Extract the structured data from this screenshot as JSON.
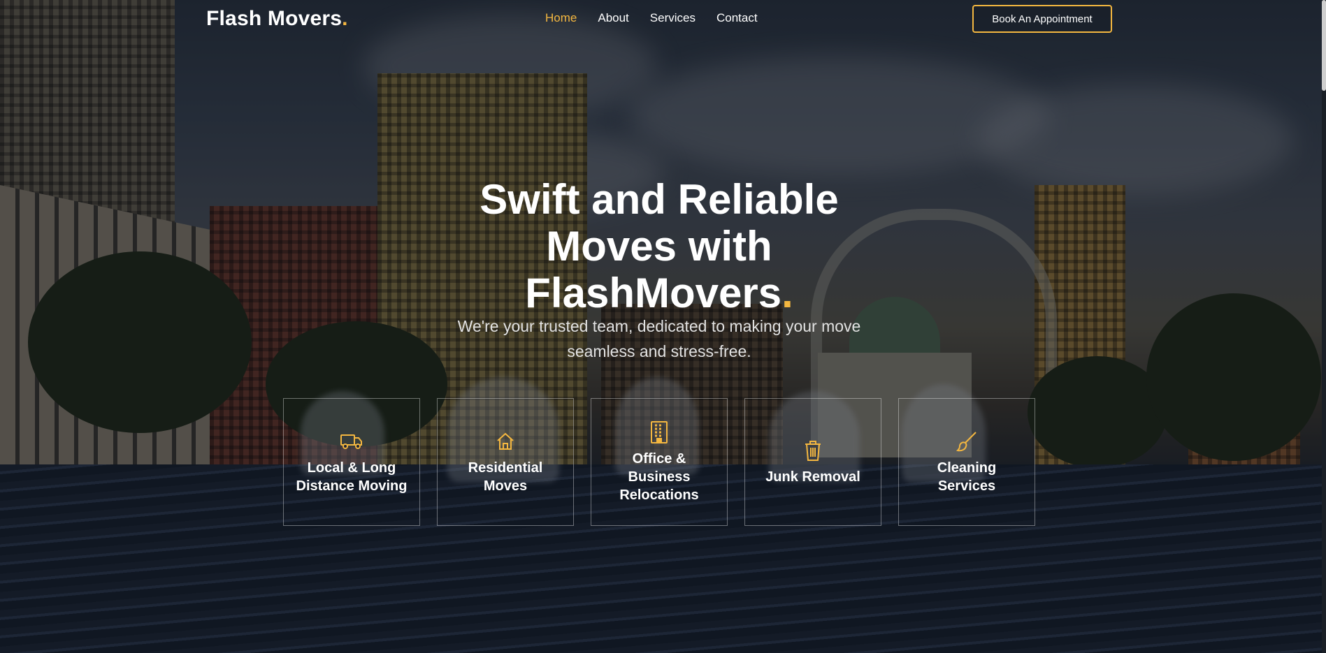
{
  "brand": {
    "name": "Flash Movers",
    "accent": "."
  },
  "nav": {
    "items": [
      {
        "label": "Home",
        "active": true
      },
      {
        "label": "About",
        "active": false
      },
      {
        "label": "Services",
        "active": false
      },
      {
        "label": "Contact",
        "active": false
      }
    ],
    "cta": "Book An Appointment"
  },
  "hero": {
    "title_line1": "Swift and Reliable",
    "title_line2": "Moves with",
    "title_line3": "FlashMovers",
    "title_accent": ".",
    "subtitle": "We're your trusted team, dedicated to making your move seamless and stress-free."
  },
  "services": [
    {
      "label": "Local & Long Distance Moving",
      "icon": "truck-icon"
    },
    {
      "label": "Residential Moves",
      "icon": "house-icon"
    },
    {
      "label": "Office & Business Relocations",
      "icon": "building-icon"
    },
    {
      "label": "Junk Removal",
      "icon": "trash-icon"
    },
    {
      "label": "Cleaning Services",
      "icon": "brush-icon"
    }
  ],
  "colors": {
    "accent": "#f4b740",
    "text": "#ffffff"
  }
}
